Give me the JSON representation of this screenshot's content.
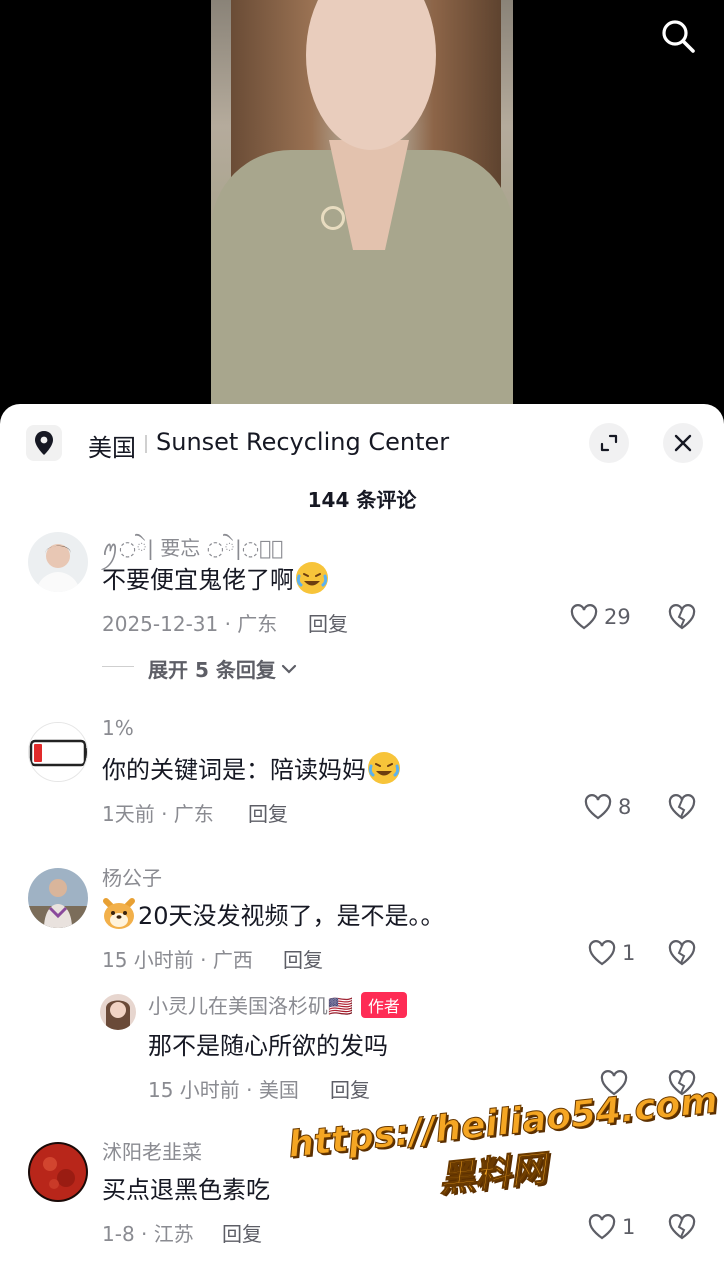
{
  "location": {
    "country": "美国",
    "place": "Sunset Recycling Center"
  },
  "comment_count": "144 条评论",
  "reply_label": "回复",
  "comments": [
    {
      "username": "ꪑ◌ེ| 要忘 ◌ེ|◌ཻ͙",
      "text": "不要便宜鬼佬了啊",
      "date": "2025-12-31 · 广东",
      "likes": "29",
      "expand": "展开 5 条回复"
    },
    {
      "username": "1%",
      "text": "你的关键词是：陪读妈妈",
      "date": "1天前 · 广东",
      "likes": "8"
    },
    {
      "username": "杨公子",
      "text": "20天没发视频了，是不是。。",
      "date": "15 小时前 · 广西",
      "likes": "1",
      "reply": {
        "username": "小灵儿在美国洛杉矶🇺🇸",
        "badge": "作者",
        "text": "那不是随心所欲的发吗",
        "date": "15 小时前 · 美国"
      }
    },
    {
      "username": "沭阳老韭菜",
      "text": "买点退黑色素吃",
      "date": "1-8 · 江苏",
      "likes": "1"
    }
  ],
  "watermark": {
    "line1": "https://heiliao54.com",
    "line2": "黑料网"
  },
  "colors": {
    "accent": "#fe2c55",
    "muted": "#8a8b91",
    "text": "#161823"
  }
}
